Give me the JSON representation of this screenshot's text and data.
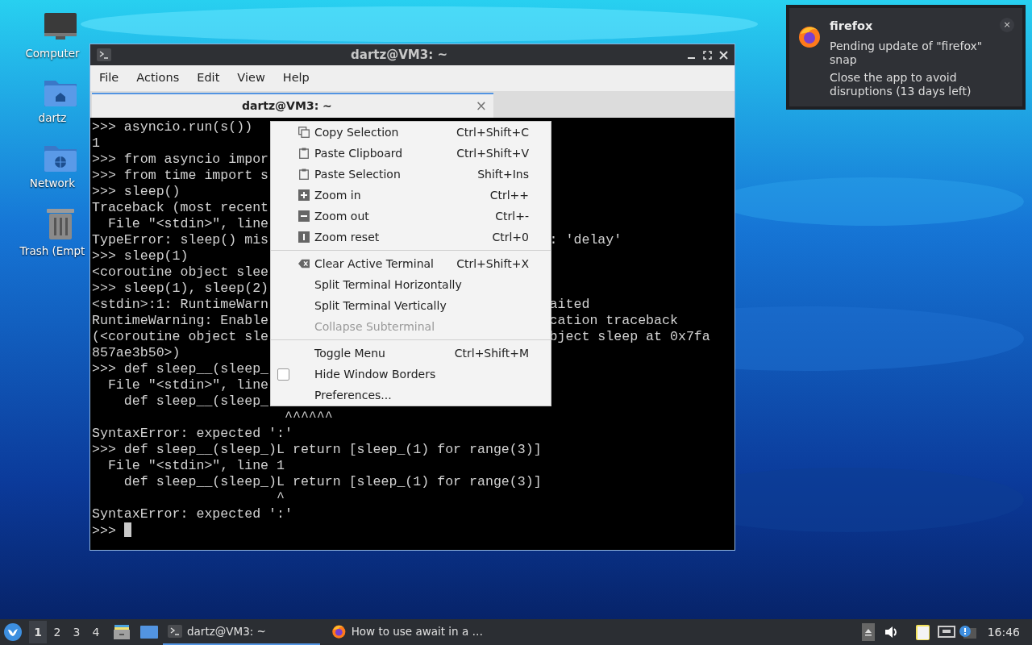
{
  "desktop_icons": [
    {
      "label": "Computer"
    },
    {
      "label": "dartz"
    },
    {
      "label": "Network"
    },
    {
      "label": "Trash (Empt"
    }
  ],
  "window": {
    "title": "dartz@VM3: ~",
    "menu": [
      "File",
      "Actions",
      "Edit",
      "View",
      "Help"
    ],
    "tabs": [
      {
        "label": "dartz@VM3: ~",
        "selected": true,
        "close": "×"
      }
    ],
    "terminal": {
      "lines": [
        {
          "text": ">>> asyncio.run(s())"
        },
        {
          "text": "1"
        },
        {
          "text": ">>> from asyncio impor"
        },
        {
          "text": ">>> from time import s"
        },
        {
          "text": ">>> sleep()"
        },
        {
          "text": "Traceback (most recent"
        },
        {
          "text": "  File \"<stdin>\", line"
        },
        {
          "text": "TypeError: sleep() mis",
          "right": ": 'delay'"
        },
        {
          "text": ">>> sleep(1)"
        },
        {
          "text": "<coroutine object slee"
        },
        {
          "text": ">>> sleep(1), sleep(2)"
        },
        {
          "text": "<stdin>:1: RuntimeWarn",
          "right": "aited"
        },
        {
          "text": "RuntimeWarning: Enable",
          "right": "cation traceback"
        },
        {
          "text": "(<coroutine object sle",
          "right": "bject sleep at 0x7fa"
        },
        {
          "text": "857ae3b50>)"
        },
        {
          "text": ">>> def sleep__(sleep_"
        },
        {
          "text": "  File \"<stdin>\", line"
        },
        {
          "text": "    def sleep__(sleep_"
        },
        {
          "text": "                        ^^^^^^"
        },
        {
          "text": "SyntaxError: expected ':'"
        },
        {
          "text": ">>> def sleep__(sleep_)L return [sleep_(1) for range(3)]"
        },
        {
          "text": "  File \"<stdin>\", line 1"
        },
        {
          "text": "    def sleep__(sleep_)L return [sleep_(1) for range(3)]"
        },
        {
          "text": "                       ^"
        },
        {
          "text": "SyntaxError: expected ':'"
        },
        {
          "text": ">>> "
        }
      ]
    }
  },
  "context_menu": {
    "sections": [
      [
        {
          "kind": "action",
          "label": "Copy Selection",
          "shortcut": "Ctrl+Shift+C",
          "disabled": false
        },
        {
          "kind": "action",
          "label": "Paste Clipboard",
          "shortcut": "Ctrl+Shift+V",
          "disabled": false
        },
        {
          "kind": "action",
          "label": "Paste Selection",
          "shortcut": "Shift+Ins",
          "disabled": false
        },
        {
          "kind": "action",
          "label": "Zoom in",
          "shortcut": "Ctrl++",
          "disabled": false
        },
        {
          "kind": "action",
          "label": "Zoom out",
          "shortcut": "Ctrl+-",
          "disabled": false
        },
        {
          "kind": "action",
          "label": "Zoom reset",
          "shortcut": "Ctrl+0",
          "disabled": false
        }
      ],
      [
        {
          "kind": "action",
          "label": "Clear Active Terminal",
          "shortcut": "Ctrl+Shift+X",
          "disabled": false
        },
        {
          "kind": "action",
          "label": "Split Terminal Horizontally",
          "disabled": false
        },
        {
          "kind": "action",
          "label": "Split Terminal Vertically",
          "disabled": false
        },
        {
          "kind": "action",
          "label": "Collapse Subterminal",
          "disabled": true
        }
      ],
      [
        {
          "kind": "action",
          "label": "Toggle Menu",
          "shortcut": "Ctrl+Shift+M",
          "disabled": false
        },
        {
          "kind": "checkbox",
          "label": "Hide Window Borders",
          "checked": false,
          "disabled": false
        },
        {
          "kind": "action",
          "label": "Preferences...",
          "disabled": false
        }
      ]
    ]
  },
  "notification": {
    "app": "firefox",
    "close": "×",
    "body": [
      "Pending update of \"firefox\" snap",
      "Close the app to avoid disruptions (13 days left)"
    ]
  },
  "taskbar": {
    "workspaces": [
      {
        "label": "1",
        "selected": true
      },
      {
        "label": "2",
        "selected": false
      },
      {
        "label": "3",
        "selected": false
      },
      {
        "label": "4",
        "selected": false
      }
    ],
    "tasks": [
      {
        "label": "dartz@VM3: ~",
        "selected": true
      },
      {
        "label": "How to use await in a …",
        "selected": false
      }
    ],
    "clock": "16:46"
  }
}
